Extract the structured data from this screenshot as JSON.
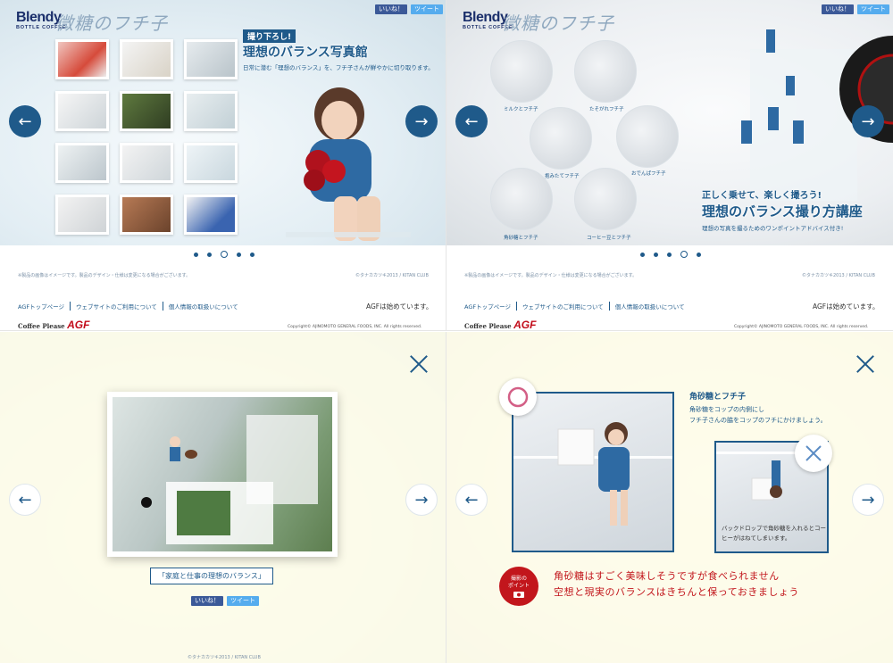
{
  "brand": {
    "logo_main": "Blendy",
    "logo_sub": "BOTTLE COFFEE",
    "title": "微糖のフチ子"
  },
  "sns": {
    "like": "いいね！",
    "tweet": "ツイート"
  },
  "nav": {
    "prev": "←",
    "next": "→"
  },
  "q1": {
    "tag": "撮り下ろし!",
    "title": "理想のバランス写真館",
    "subtitle": "日常に潜む「理想のバランス」を、フチ子さんが鮮やかに切り取ります。",
    "dots": 5,
    "active_dot": 3
  },
  "q2": {
    "labels": [
      "ミルクとフチ子",
      "たそがれフチ子",
      "抱みたてフチ子",
      "おでんぱフチ子",
      "角砂糖とフチ子",
      "コーヒー豆とフチ子"
    ],
    "tag": "正しく乗せて、楽しく撮ろう!",
    "title": "理想のバランス撮り方講座",
    "subtitle": "理想の写真を撮るためのワンポイントアドバイス付き!",
    "dots": 5,
    "active_dot": 4
  },
  "footer": {
    "note": "※製品の画像はイメージです。製品のデザイン・仕様は変更になる場合がございます。",
    "credit": "©タナカカツキ2013 / KITAN CLUB",
    "links": [
      "AGFトップページ",
      "ウェブサイトのご利用について",
      "個人情報の取扱いについて"
    ],
    "agf_slogan": "AGFは始めています。",
    "coffee_please": "Coffee Please",
    "agf": "AGF",
    "copyright": "Copyright© AJINOMOTO GENERAL FOODS, INC. All rights reserved."
  },
  "q3": {
    "caption": "「家庭と仕事の理想のバランス」"
  },
  "q4": {
    "heading": "角砂糖とフチ子",
    "desc_lines": [
      "角砂糖をコップの内側にし",
      "フチ子さんの脇をコップのフチにかけましょう。"
    ],
    "wrong_desc": "バックドロップで角砂糖を入れるとコーヒーがはねてしまいます。",
    "point_label": [
      "撮影の",
      "ポイント"
    ],
    "point_lines": [
      "角砂糖はすごく美味しそうですが食べられません",
      "空想と現実のバランスはきちんと保っておきましょう"
    ]
  },
  "colors": {
    "accent": "#1f5a8a",
    "overlay": "#fffde8",
    "point": "#c2161c"
  }
}
